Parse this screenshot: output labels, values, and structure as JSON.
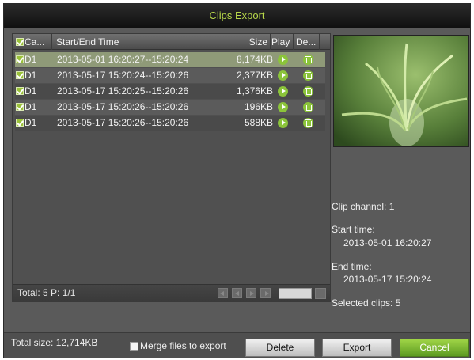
{
  "window": {
    "title": "Clips Export"
  },
  "table": {
    "headers": {
      "camera": "Ca...",
      "time": "Start/End Time",
      "size": "Size",
      "play": "Play",
      "delete": "De..."
    },
    "rows": [
      {
        "camera": "D1",
        "time": "2013-05-01 16:20:27--15:20:24",
        "size": "8,174KB",
        "selected": true
      },
      {
        "camera": "D1",
        "time": "2013-05-17 15:20:24--15:20:26",
        "size": "2,377KB",
        "selected": false
      },
      {
        "camera": "D1",
        "time": "2013-05-17 15:20:25--15:20:26",
        "size": "1,376KB",
        "selected": false
      },
      {
        "camera": "D1",
        "time": "2013-05-17 15:20:26--15:20:26",
        "size": "196KB",
        "selected": false
      },
      {
        "camera": "D1",
        "time": "2013-05-17 15:20:26--15:20:26",
        "size": "588KB",
        "selected": false
      }
    ],
    "footer": {
      "total_label": "Total: 5  P: 1/1"
    }
  },
  "info": {
    "clip_channel": "Clip channel: 1",
    "start_time_label": "Start time:",
    "start_time_value": "2013-05-01 16:20:27",
    "end_time_label": "End time:",
    "end_time_value": "2013-05-17 15:20:24",
    "selected_clips": "Selected clips: 5"
  },
  "bottom": {
    "total_size": "Total size: 12,714KB",
    "merge_label": "Merge files to export",
    "delete_label": "Delete",
    "export_label": "Export",
    "cancel_label": "Cancel"
  },
  "colors": {
    "accent_green": "#8bc43a",
    "title_text": "#b8d84a",
    "selected_row": "#8f9a78"
  }
}
